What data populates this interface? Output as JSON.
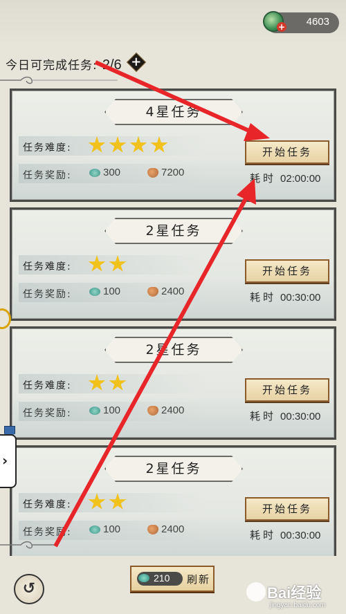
{
  "currency": {
    "icon": "jade-coin-icon",
    "amount": "4603"
  },
  "daily": {
    "label": "今日可完成任务:",
    "count": "2/6",
    "add_icon": "plus-icon"
  },
  "labels": {
    "difficulty": "任务难度:",
    "reward": "任务奖励:",
    "start": "开始任务",
    "time": "耗时"
  },
  "tasks": [
    {
      "title": "4星任务",
      "stars": 4,
      "jade": "300",
      "coin": "7200",
      "time": "02:00:00"
    },
    {
      "title": "2星任务",
      "stars": 2,
      "jade": "100",
      "coin": "2400",
      "time": "00:30:00"
    },
    {
      "title": "2星任务",
      "stars": 2,
      "jade": "100",
      "coin": "2400",
      "time": "00:30:00"
    },
    {
      "title": "2星任务",
      "stars": 2,
      "jade": "100",
      "coin": "2400",
      "time": "00:30:00"
    }
  ],
  "bottom": {
    "back_icon": "back-swirl-icon",
    "refresh_cost": "210",
    "refresh_label": "刷新"
  },
  "watermark": {
    "text": "Bai经验",
    "sub": "jingyan.baidu.com"
  },
  "colors": {
    "arrow": "#e8262a",
    "star": "#f1c21b",
    "card_border": "#4a4a48",
    "button_border": "#8b5a2b"
  }
}
